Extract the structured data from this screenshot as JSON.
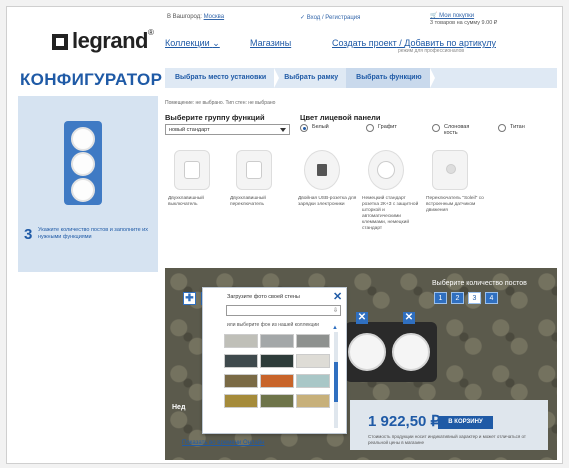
{
  "header": {
    "logo": "legrand",
    "city_label": "В Вашгород:",
    "city_value": "Москва",
    "login_label": "Вход / Регистрация",
    "cart_link": "Мои покупки",
    "cart_info": "3 товаров на сумму 9.00 ₽",
    "nav": {
      "collections": "Коллекции",
      "stores": "Магазины",
      "create_project": "Создать проект",
      "add_article": "Добавить по артикулу",
      "pro_note": "режим для профессионалов"
    }
  },
  "configurator": {
    "title": "КОНФИГУРАТОР",
    "steps": [
      "Выбрать место установки",
      "Выбрать рамку",
      "Выбрать функцию"
    ],
    "active_step": 2
  },
  "left_panel": {
    "hint_number": "3",
    "hint_text": "Укажите количество постов и заполните их нужными функциями"
  },
  "functions": {
    "breadcrumb": "Помещение: не выбрано. Тип стен: не выбрано",
    "group_label": "Выберите группу функций",
    "group_value": "новый стандарт",
    "color_label": "Цвет лицевой панели",
    "colors": [
      {
        "label": "Белый",
        "selected": true
      },
      {
        "label": "Графит",
        "selected": false
      },
      {
        "label": "Слоновая кость",
        "selected": false
      },
      {
        "label": "Титан",
        "selected": false
      }
    ],
    "items": [
      {
        "caption": "Двухклавишный выключатель"
      },
      {
        "caption": "Двухклавишный переключатель"
      },
      {
        "caption": "Двойная USB-розетка для зарядки электроники"
      },
      {
        "caption": "Немецкий стандарт розетка 2К+З с защитной шторкой и автоматическими клеммами, немецкий стандарт"
      },
      {
        "caption": "Переключатель \"Soleil\" со встроенным датчиком движения"
      }
    ]
  },
  "preview": {
    "posts_label": "Выберите количество постов",
    "posts": [
      "1",
      "2",
      "3",
      "4"
    ],
    "selected_post": "4",
    "price": "1 922,50 ₽",
    "cart_button": "В КОРЗИНУ",
    "price_note": "Стоимость продукции носит индикативный характер и может отличаться от реальной цены в магазине",
    "ned_label": "Нед",
    "show_link": "Показать во времени Онлайн"
  },
  "wall_popup": {
    "title": "Загрузите фото своей стены",
    "hint": "или выберите фон из нашей коллекции",
    "close_label": "✕",
    "tile_colors": [
      "#bfbfb8",
      "#a3a7a8",
      "#8e918f",
      "#3f4a4d",
      "#2e3c3a",
      "#dedcd6",
      "#7a6a45",
      "#c8642a",
      "#a9c7c7",
      "#a58b3a",
      "#6e744a",
      "#c7b07a"
    ]
  }
}
